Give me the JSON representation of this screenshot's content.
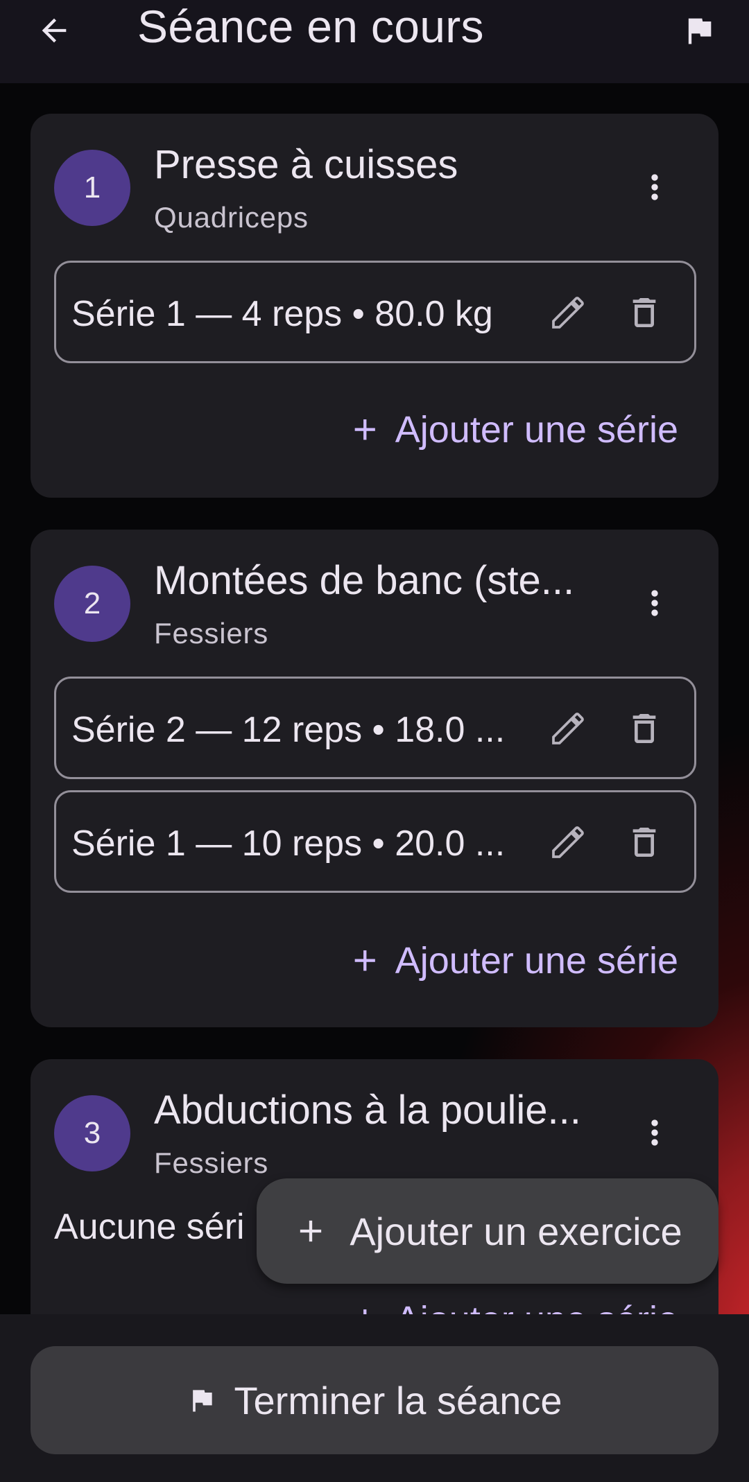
{
  "header": {
    "title": "Séance en cours",
    "back_icon": "arrow-back-icon",
    "flag_icon": "flag-icon"
  },
  "exercises": [
    {
      "index": "1",
      "name": "Presse à cuisses",
      "muscle": "Quadriceps",
      "sets": [
        {
          "label": "Série 1 — 4 reps • 80.0 kg"
        }
      ],
      "add_set_label": "Ajouter une série"
    },
    {
      "index": "2",
      "name": "Montées de banc (ste...",
      "muscle": "Fessiers",
      "sets": [
        {
          "label": "Série 2 — 12 reps • 18.0 ..."
        },
        {
          "label": "Série 1 — 10 reps • 20.0 ..."
        }
      ],
      "add_set_label": "Ajouter une série"
    },
    {
      "index": "3",
      "name": "Abductions à la poulie...",
      "muscle": "Fessiers",
      "sets": [],
      "empty_text": "Aucune séri",
      "add_set_label": "Ajouter une série"
    }
  ],
  "fab": {
    "label": "Ajouter un exercice",
    "icon": "plus-icon"
  },
  "bottom": {
    "finish_label": "Terminer la séance",
    "icon": "flag-icon"
  },
  "colors": {
    "background": "#060608",
    "app_bar": "#16141c",
    "card": "#1e1d22",
    "badge": "#4f3a8c",
    "accent_text": "#d0bcff",
    "outline": "#938f99",
    "fab": "#3f3f42",
    "red_glow": "#d0272c"
  }
}
